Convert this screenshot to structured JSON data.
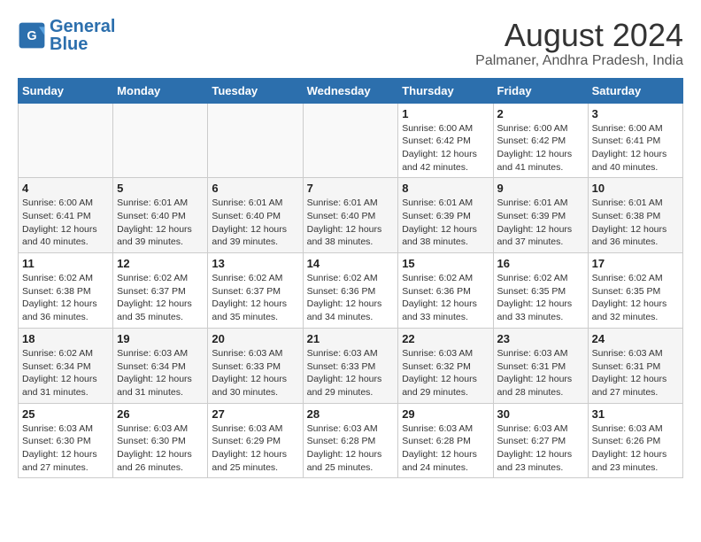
{
  "header": {
    "logo_text_general": "General",
    "logo_text_blue": "Blue",
    "month_year": "August 2024",
    "location": "Palmaner, Andhra Pradesh, India"
  },
  "weekdays": [
    "Sunday",
    "Monday",
    "Tuesday",
    "Wednesday",
    "Thursday",
    "Friday",
    "Saturday"
  ],
  "weeks": [
    [
      {
        "day": "",
        "info": ""
      },
      {
        "day": "",
        "info": ""
      },
      {
        "day": "",
        "info": ""
      },
      {
        "day": "",
        "info": ""
      },
      {
        "day": "1",
        "info": "Sunrise: 6:00 AM\nSunset: 6:42 PM\nDaylight: 12 hours\nand 42 minutes."
      },
      {
        "day": "2",
        "info": "Sunrise: 6:00 AM\nSunset: 6:42 PM\nDaylight: 12 hours\nand 41 minutes."
      },
      {
        "day": "3",
        "info": "Sunrise: 6:00 AM\nSunset: 6:41 PM\nDaylight: 12 hours\nand 40 minutes."
      }
    ],
    [
      {
        "day": "4",
        "info": "Sunrise: 6:00 AM\nSunset: 6:41 PM\nDaylight: 12 hours\nand 40 minutes."
      },
      {
        "day": "5",
        "info": "Sunrise: 6:01 AM\nSunset: 6:40 PM\nDaylight: 12 hours\nand 39 minutes."
      },
      {
        "day": "6",
        "info": "Sunrise: 6:01 AM\nSunset: 6:40 PM\nDaylight: 12 hours\nand 39 minutes."
      },
      {
        "day": "7",
        "info": "Sunrise: 6:01 AM\nSunset: 6:40 PM\nDaylight: 12 hours\nand 38 minutes."
      },
      {
        "day": "8",
        "info": "Sunrise: 6:01 AM\nSunset: 6:39 PM\nDaylight: 12 hours\nand 38 minutes."
      },
      {
        "day": "9",
        "info": "Sunrise: 6:01 AM\nSunset: 6:39 PM\nDaylight: 12 hours\nand 37 minutes."
      },
      {
        "day": "10",
        "info": "Sunrise: 6:01 AM\nSunset: 6:38 PM\nDaylight: 12 hours\nand 36 minutes."
      }
    ],
    [
      {
        "day": "11",
        "info": "Sunrise: 6:02 AM\nSunset: 6:38 PM\nDaylight: 12 hours\nand 36 minutes."
      },
      {
        "day": "12",
        "info": "Sunrise: 6:02 AM\nSunset: 6:37 PM\nDaylight: 12 hours\nand 35 minutes."
      },
      {
        "day": "13",
        "info": "Sunrise: 6:02 AM\nSunset: 6:37 PM\nDaylight: 12 hours\nand 35 minutes."
      },
      {
        "day": "14",
        "info": "Sunrise: 6:02 AM\nSunset: 6:36 PM\nDaylight: 12 hours\nand 34 minutes."
      },
      {
        "day": "15",
        "info": "Sunrise: 6:02 AM\nSunset: 6:36 PM\nDaylight: 12 hours\nand 33 minutes."
      },
      {
        "day": "16",
        "info": "Sunrise: 6:02 AM\nSunset: 6:35 PM\nDaylight: 12 hours\nand 33 minutes."
      },
      {
        "day": "17",
        "info": "Sunrise: 6:02 AM\nSunset: 6:35 PM\nDaylight: 12 hours\nand 32 minutes."
      }
    ],
    [
      {
        "day": "18",
        "info": "Sunrise: 6:02 AM\nSunset: 6:34 PM\nDaylight: 12 hours\nand 31 minutes."
      },
      {
        "day": "19",
        "info": "Sunrise: 6:03 AM\nSunset: 6:34 PM\nDaylight: 12 hours\nand 31 minutes."
      },
      {
        "day": "20",
        "info": "Sunrise: 6:03 AM\nSunset: 6:33 PM\nDaylight: 12 hours\nand 30 minutes."
      },
      {
        "day": "21",
        "info": "Sunrise: 6:03 AM\nSunset: 6:33 PM\nDaylight: 12 hours\nand 29 minutes."
      },
      {
        "day": "22",
        "info": "Sunrise: 6:03 AM\nSunset: 6:32 PM\nDaylight: 12 hours\nand 29 minutes."
      },
      {
        "day": "23",
        "info": "Sunrise: 6:03 AM\nSunset: 6:31 PM\nDaylight: 12 hours\nand 28 minutes."
      },
      {
        "day": "24",
        "info": "Sunrise: 6:03 AM\nSunset: 6:31 PM\nDaylight: 12 hours\nand 27 minutes."
      }
    ],
    [
      {
        "day": "25",
        "info": "Sunrise: 6:03 AM\nSunset: 6:30 PM\nDaylight: 12 hours\nand 27 minutes."
      },
      {
        "day": "26",
        "info": "Sunrise: 6:03 AM\nSunset: 6:30 PM\nDaylight: 12 hours\nand 26 minutes."
      },
      {
        "day": "27",
        "info": "Sunrise: 6:03 AM\nSunset: 6:29 PM\nDaylight: 12 hours\nand 25 minutes."
      },
      {
        "day": "28",
        "info": "Sunrise: 6:03 AM\nSunset: 6:28 PM\nDaylight: 12 hours\nand 25 minutes."
      },
      {
        "day": "29",
        "info": "Sunrise: 6:03 AM\nSunset: 6:28 PM\nDaylight: 12 hours\nand 24 minutes."
      },
      {
        "day": "30",
        "info": "Sunrise: 6:03 AM\nSunset: 6:27 PM\nDaylight: 12 hours\nand 23 minutes."
      },
      {
        "day": "31",
        "info": "Sunrise: 6:03 AM\nSunset: 6:26 PM\nDaylight: 12 hours\nand 23 minutes."
      }
    ]
  ]
}
